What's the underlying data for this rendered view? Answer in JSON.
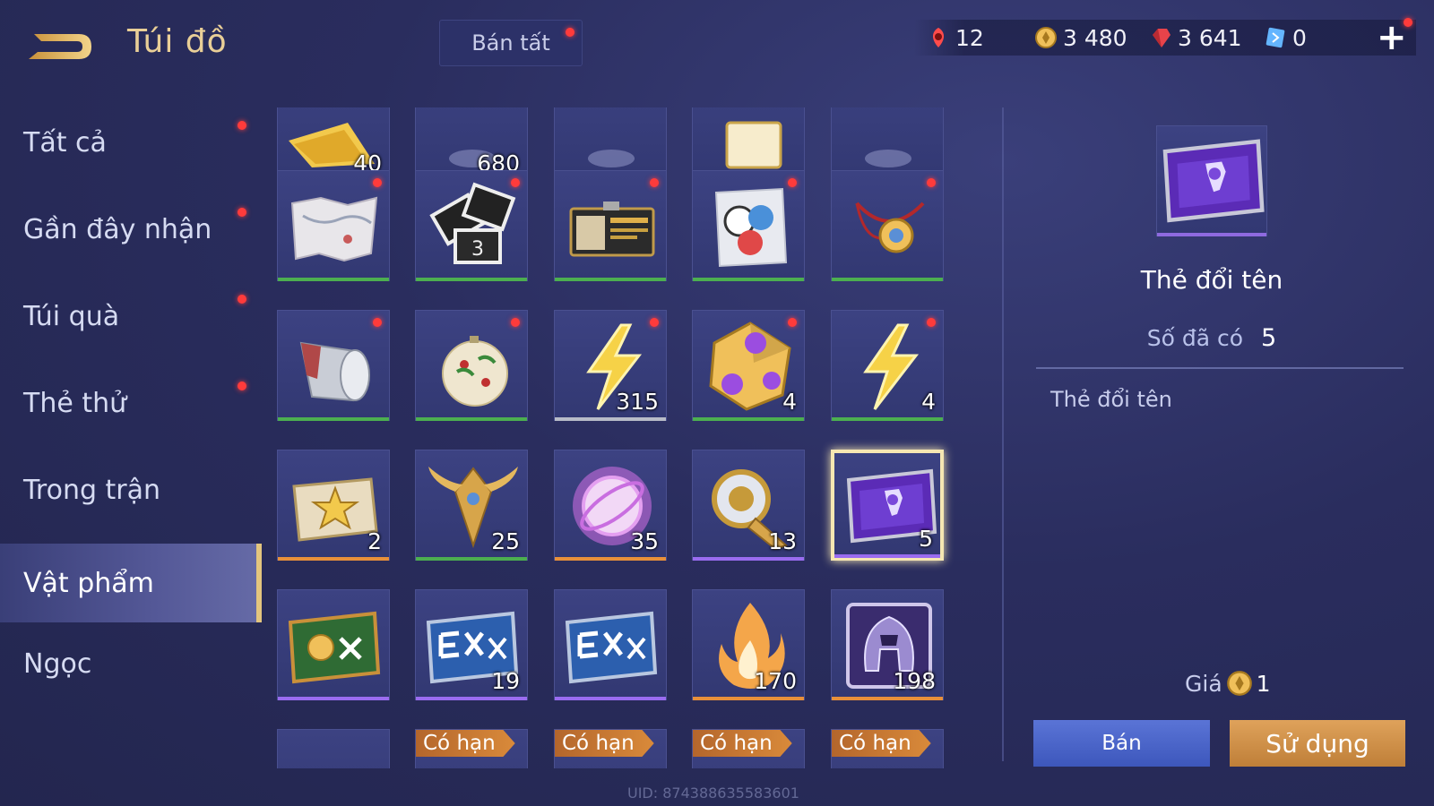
{
  "header": {
    "title": "Túi đồ",
    "sell_all_label": "Bán tất"
  },
  "currencies": [
    {
      "icon": "red-token-icon",
      "value": "12",
      "color": "#ff4b4b"
    },
    {
      "icon": "gold-coin-icon",
      "value": "3 480",
      "color": "#f0c05a"
    },
    {
      "icon": "ruby-icon",
      "value": "3 641",
      "color": "#e8434a"
    },
    {
      "icon": "voucher-icon",
      "value": "0",
      "color": "#64b5ff"
    }
  ],
  "sidebar": {
    "items": [
      {
        "label": "Tất cả",
        "dot": true
      },
      {
        "label": "Gần đây nhận",
        "dot": true
      },
      {
        "label": "Túi quà",
        "dot": true
      },
      {
        "label": "Thẻ thử",
        "dot": true
      },
      {
        "label": "Trong trận",
        "dot": false
      },
      {
        "label": "Vật phẩm",
        "dot": false,
        "active": true
      },
      {
        "label": "Ngọc",
        "dot": false
      }
    ]
  },
  "grid": {
    "rows": [
      [
        {
          "icon": "golden-ticket-icon",
          "count": "40",
          "rarity": "green",
          "dot": false
        },
        {
          "icon": "item-icon",
          "count": "680",
          "rarity": "green",
          "dot": false
        },
        {
          "icon": "item-icon",
          "count": "",
          "rarity": "green",
          "dot": false
        },
        {
          "icon": "note-icon",
          "count": "",
          "rarity": "green",
          "dot": false
        },
        {
          "icon": "item-icon",
          "count": "",
          "rarity": "green",
          "dot": false
        }
      ],
      [
        {
          "icon": "map-icon",
          "count": "",
          "rarity": "green",
          "dot": true
        },
        {
          "icon": "photo-cards-icon",
          "count": "",
          "rarity": "green",
          "dot": true
        },
        {
          "icon": "work-permit-icon",
          "count": "",
          "rarity": "green",
          "dot": true
        },
        {
          "icon": "sticker-bag-icon",
          "count": "",
          "rarity": "green",
          "dot": true
        },
        {
          "icon": "medal-necklace-icon",
          "count": "",
          "rarity": "green",
          "dot": true
        }
      ],
      [
        {
          "icon": "cup-icon",
          "count": "",
          "rarity": "green",
          "dot": true
        },
        {
          "icon": "ornament-icon",
          "count": "",
          "rarity": "green",
          "dot": true
        },
        {
          "icon": "lightning-icon",
          "count": "315",
          "rarity": "white",
          "dot": true
        },
        {
          "icon": "dice-icon",
          "count": "4",
          "rarity": "green",
          "dot": true
        },
        {
          "icon": "lightning-icon",
          "count": "4",
          "rarity": "green",
          "dot": true
        }
      ],
      [
        {
          "icon": "star-ticket-icon",
          "count": "2",
          "rarity": "orange",
          "dot": false
        },
        {
          "icon": "winged-emblem-icon",
          "count": "25",
          "rarity": "green",
          "dot": false
        },
        {
          "icon": "crystal-orb-icon",
          "count": "35",
          "rarity": "orange",
          "dot": false
        },
        {
          "icon": "golden-horn-icon",
          "count": "13",
          "rarity": "purple",
          "dot": false
        },
        {
          "icon": "rename-card-icon",
          "count": "5",
          "rarity": "purple",
          "dot": false,
          "selected": true
        }
      ],
      [
        {
          "icon": "gold-x2-card-icon",
          "count": "",
          "rarity": "purple",
          "dot": false
        },
        {
          "icon": "exp-x2-card-icon",
          "count": "19",
          "rarity": "purple",
          "dot": false
        },
        {
          "icon": "exp-x2-card-icon",
          "count": "",
          "rarity": "purple",
          "dot": false
        },
        {
          "icon": "flame-icon",
          "count": "170",
          "rarity": "orange",
          "dot": false
        },
        {
          "icon": "helmet-icon",
          "count": "198",
          "rarity": "orange",
          "dot": false
        }
      ],
      [
        {
          "icon": "item-icon",
          "tag": "",
          "rarity": "none"
        },
        {
          "icon": "item-icon",
          "tag": "Có hạn",
          "rarity": "none"
        },
        {
          "icon": "item-icon",
          "tag": "Có hạn",
          "rarity": "none"
        },
        {
          "icon": "item-icon",
          "tag": "Có hạn",
          "rarity": "none"
        },
        {
          "icon": "item-icon",
          "tag": "Có hạn",
          "rarity": "none"
        }
      ]
    ]
  },
  "rarity_colors": {
    "green": "#4caf50",
    "white": "#b8bcc8",
    "orange": "#e8903a",
    "purple": "#9a6cf0",
    "none": "transparent"
  },
  "detail": {
    "name": "Thẻ đổi tên",
    "owned_label": "Số đã có",
    "owned_value": "5",
    "description": "Thẻ đổi tên",
    "price_label": "Giá",
    "price_value": "1",
    "sell_label": "Bán",
    "use_label": "Sử dụng"
  },
  "uid_text": "UID: 874388635583601"
}
